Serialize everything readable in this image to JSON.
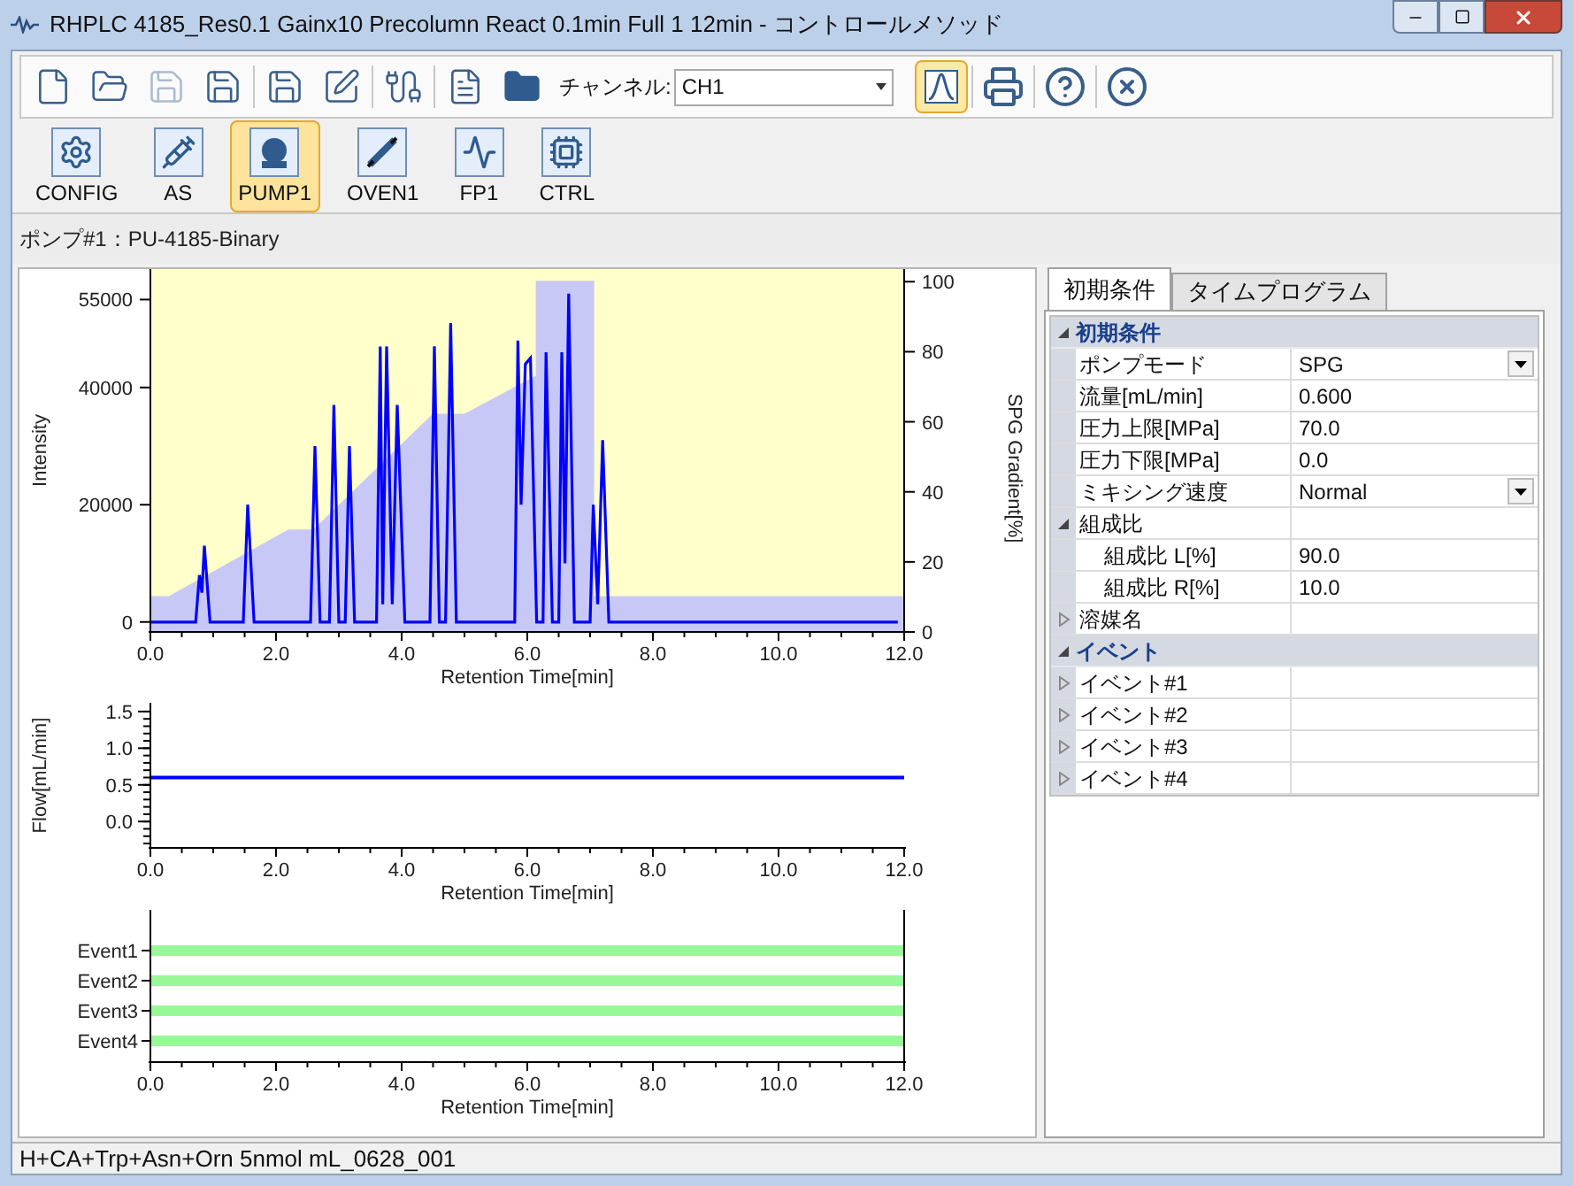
{
  "window": {
    "title": "RHPLC 4185_Res0.1 Gainx10 Precolumn React 0.1min Full 1 12min - コントロールメソッド"
  },
  "toolbar": {
    "buttons_left": [
      {
        "pressed": false,
        "disabled": false
      },
      {
        "pressed": false,
        "disabled": false
      },
      {
        "pressed": false,
        "disabled": true
      },
      {
        "pressed": false,
        "disabled": false
      },
      {
        "pressed": false,
        "disabled": false
      },
      {
        "pressed": false,
        "disabled": false
      },
      {
        "pressed": false,
        "disabled": false
      },
      {
        "pressed": false,
        "disabled": false
      },
      {
        "pressed": false,
        "disabled": false
      }
    ],
    "channel": {
      "label": "チャンネル:",
      "value": "CH1"
    },
    "buttons_right": [
      {
        "pressed": true,
        "disabled": false
      },
      {
        "pressed": false,
        "disabled": false
      },
      {
        "pressed": false,
        "disabled": false
      },
      {
        "pressed": false,
        "disabled": false
      }
    ]
  },
  "devices": [
    {
      "label": "CONFIG",
      "selected": false
    },
    {
      "label": "AS",
      "selected": false
    },
    {
      "label": "PUMP1",
      "selected": true
    },
    {
      "label": "OVEN1",
      "selected": false
    },
    {
      "label": "FP1",
      "selected": false
    },
    {
      "label": "CTRL",
      "selected": false
    }
  ],
  "device_caption": "ポンプ#1：PU-4185-Binary",
  "chromatogram": {
    "gradient": {
      "chart_data": {
        "type": "area",
        "ylabel": "SPG Gradient[%]",
        "xlim": [
          0,
          12
        ],
        "ylim": [
          0,
          103.6
        ],
        "yticks": [
          0,
          20,
          40,
          60,
          80,
          100
        ],
        "x": [
          0,
          0.3,
          2.2,
          2.6,
          4.5,
          5.0,
          6.15,
          6.15,
          7.05,
          7.05,
          12.0
        ],
        "series": [
          {
            "color": "#c8c8f6",
            "values": [
              10,
              10,
              29,
              29,
              62,
              62,
              73,
              100,
              100,
              10,
              10
            ]
          }
        ]
      }
    },
    "intensity": {
      "chart_data": {
        "type": "line",
        "xlabel": "Retention Time[min]",
        "ylabel": "Intensity",
        "xlim": [
          0,
          12
        ],
        "ylim": [
          -1700,
          60200
        ],
        "xticks": [
          {
            "value": 0,
            "label": "0.0"
          },
          {
            "value": 2,
            "label": "2.0"
          },
          {
            "value": 4,
            "label": "4.0"
          },
          {
            "value": 6,
            "label": "6.0"
          },
          {
            "value": 8,
            "label": "8.0"
          },
          {
            "value": 10,
            "label": "10.0"
          },
          {
            "value": 12,
            "label": "12.0"
          }
        ],
        "yticks": [
          0,
          20000,
          40000,
          55000
        ],
        "x": [
          0,
          0.72,
          0.78,
          0.82,
          0.86,
          0.95,
          1.48,
          1.55,
          1.65,
          2.55,
          2.62,
          2.7,
          2.85,
          2.92,
          3.0,
          3.1,
          3.17,
          3.25,
          3.6,
          3.66,
          3.7,
          3.76,
          3.85,
          3.93,
          4.05,
          4.45,
          4.52,
          4.6,
          4.7,
          4.78,
          4.87,
          5.8,
          5.85,
          5.9,
          5.97,
          6.05,
          6.15,
          6.25,
          6.3,
          6.4,
          6.5,
          6.55,
          6.6,
          6.66,
          6.75,
          7.0,
          7.05,
          7.12,
          7.2,
          7.3,
          11.9
        ],
        "series": [
          {
            "color": "#0000ff",
            "values": [
              0,
              0,
              8000,
              5000,
              13000,
              0,
              0,
              20000,
              0,
              0,
              30000,
              0,
              0,
              37000,
              0,
              0,
              30000,
              0,
              0,
              47000,
              3000,
              47000,
              3000,
              37000,
              0,
              0,
              47000,
              0,
              0,
              51000,
              0,
              0,
              48000,
              20000,
              44000,
              45000,
              0,
              0,
              46000,
              0,
              0,
              46000,
              10000,
              56000,
              0,
              0,
              20000,
              3000,
              31000,
              0,
              0
            ]
          }
        ]
      }
    }
  },
  "flow": {
    "chart_data": {
      "type": "line",
      "xlabel": "Retention Time[min]",
      "ylabel": "Flow[mL/min]",
      "xlim": [
        0,
        12
      ],
      "ylim": [
        -0.36,
        1.62
      ],
      "xticks": [
        {
          "value": 0,
          "label": "0.0"
        },
        {
          "value": 2,
          "label": "2.0"
        },
        {
          "value": 4,
          "label": "4.0"
        },
        {
          "value": 6,
          "label": "6.0"
        },
        {
          "value": 8,
          "label": "8.0"
        },
        {
          "value": 10,
          "label": "10.0"
        },
        {
          "value": 12,
          "label": "12.0"
        }
      ],
      "yticks": [
        {
          "value": 0,
          "label": "0.0"
        },
        {
          "value": 0.5,
          "label": "0.5"
        },
        {
          "value": 1,
          "label": "1.0"
        },
        {
          "value": 1.5,
          "label": "1.5"
        }
      ],
      "x": [
        0,
        12
      ],
      "series": [
        {
          "color": "#0000ff",
          "values": [
            0.6,
            0.6
          ]
        }
      ]
    }
  },
  "events": {
    "chart_data": {
      "type": "bar",
      "orientation": "horizontal",
      "xlabel": "Retention Time[min]",
      "xlim": [
        0,
        12
      ],
      "xticks": [
        {
          "value": 0,
          "label": "0.0"
        },
        {
          "value": 2,
          "label": "2.0"
        },
        {
          "value": 4,
          "label": "4.0"
        },
        {
          "value": 6,
          "label": "6.0"
        },
        {
          "value": 8,
          "label": "8.0"
        },
        {
          "value": 10,
          "label": "10.0"
        },
        {
          "value": 12,
          "label": "12.0"
        }
      ],
      "categories": [
        "Event1",
        "Event2",
        "Event3",
        "Event4"
      ],
      "series": [
        {
          "color": "#98f898",
          "values": [
            12,
            12,
            12,
            12
          ]
        }
      ]
    }
  },
  "tabs": [
    {
      "label": "初期条件",
      "selected": true
    },
    {
      "label": "タイムプログラム",
      "selected": false
    }
  ],
  "property_grid": [
    {
      "kind": "category",
      "label": "初期条件",
      "expanded": true,
      "children": [
        {
          "kind": "dropdown",
          "label": "ポンプモード",
          "value": "SPG"
        },
        {
          "kind": "text",
          "label": "流量[mL/min]",
          "value": "0.600"
        },
        {
          "kind": "text",
          "label": "圧力上限[MPa]",
          "value": "70.0"
        },
        {
          "kind": "text",
          "label": "圧力下限[MPa]",
          "value": "0.0"
        },
        {
          "kind": "dropdown",
          "label": "ミキシング速度",
          "value": "Normal"
        },
        {
          "kind": "group",
          "label": "組成比",
          "expanded": true,
          "children": [
            {
              "kind": "text",
              "label": "組成比 L[%]",
              "value": "90.0"
            },
            {
              "kind": "text",
              "label": "組成比 R[%]",
              "value": "10.0"
            }
          ]
        },
        {
          "kind": "group",
          "label": "溶媒名",
          "expanded": false
        }
      ]
    },
    {
      "kind": "category",
      "label": "イベント",
      "expanded": true,
      "children": [
        {
          "kind": "group",
          "label": "イベント#1",
          "expanded": false
        },
        {
          "kind": "group",
          "label": "イベント#2",
          "expanded": false
        },
        {
          "kind": "group",
          "label": "イベント#3",
          "expanded": false
        },
        {
          "kind": "group",
          "label": "イベント#4",
          "expanded": false
        }
      ]
    }
  ],
  "status_bar": "H+CA+Trp+Asn+Orn 5nmol mL_0628_001"
}
